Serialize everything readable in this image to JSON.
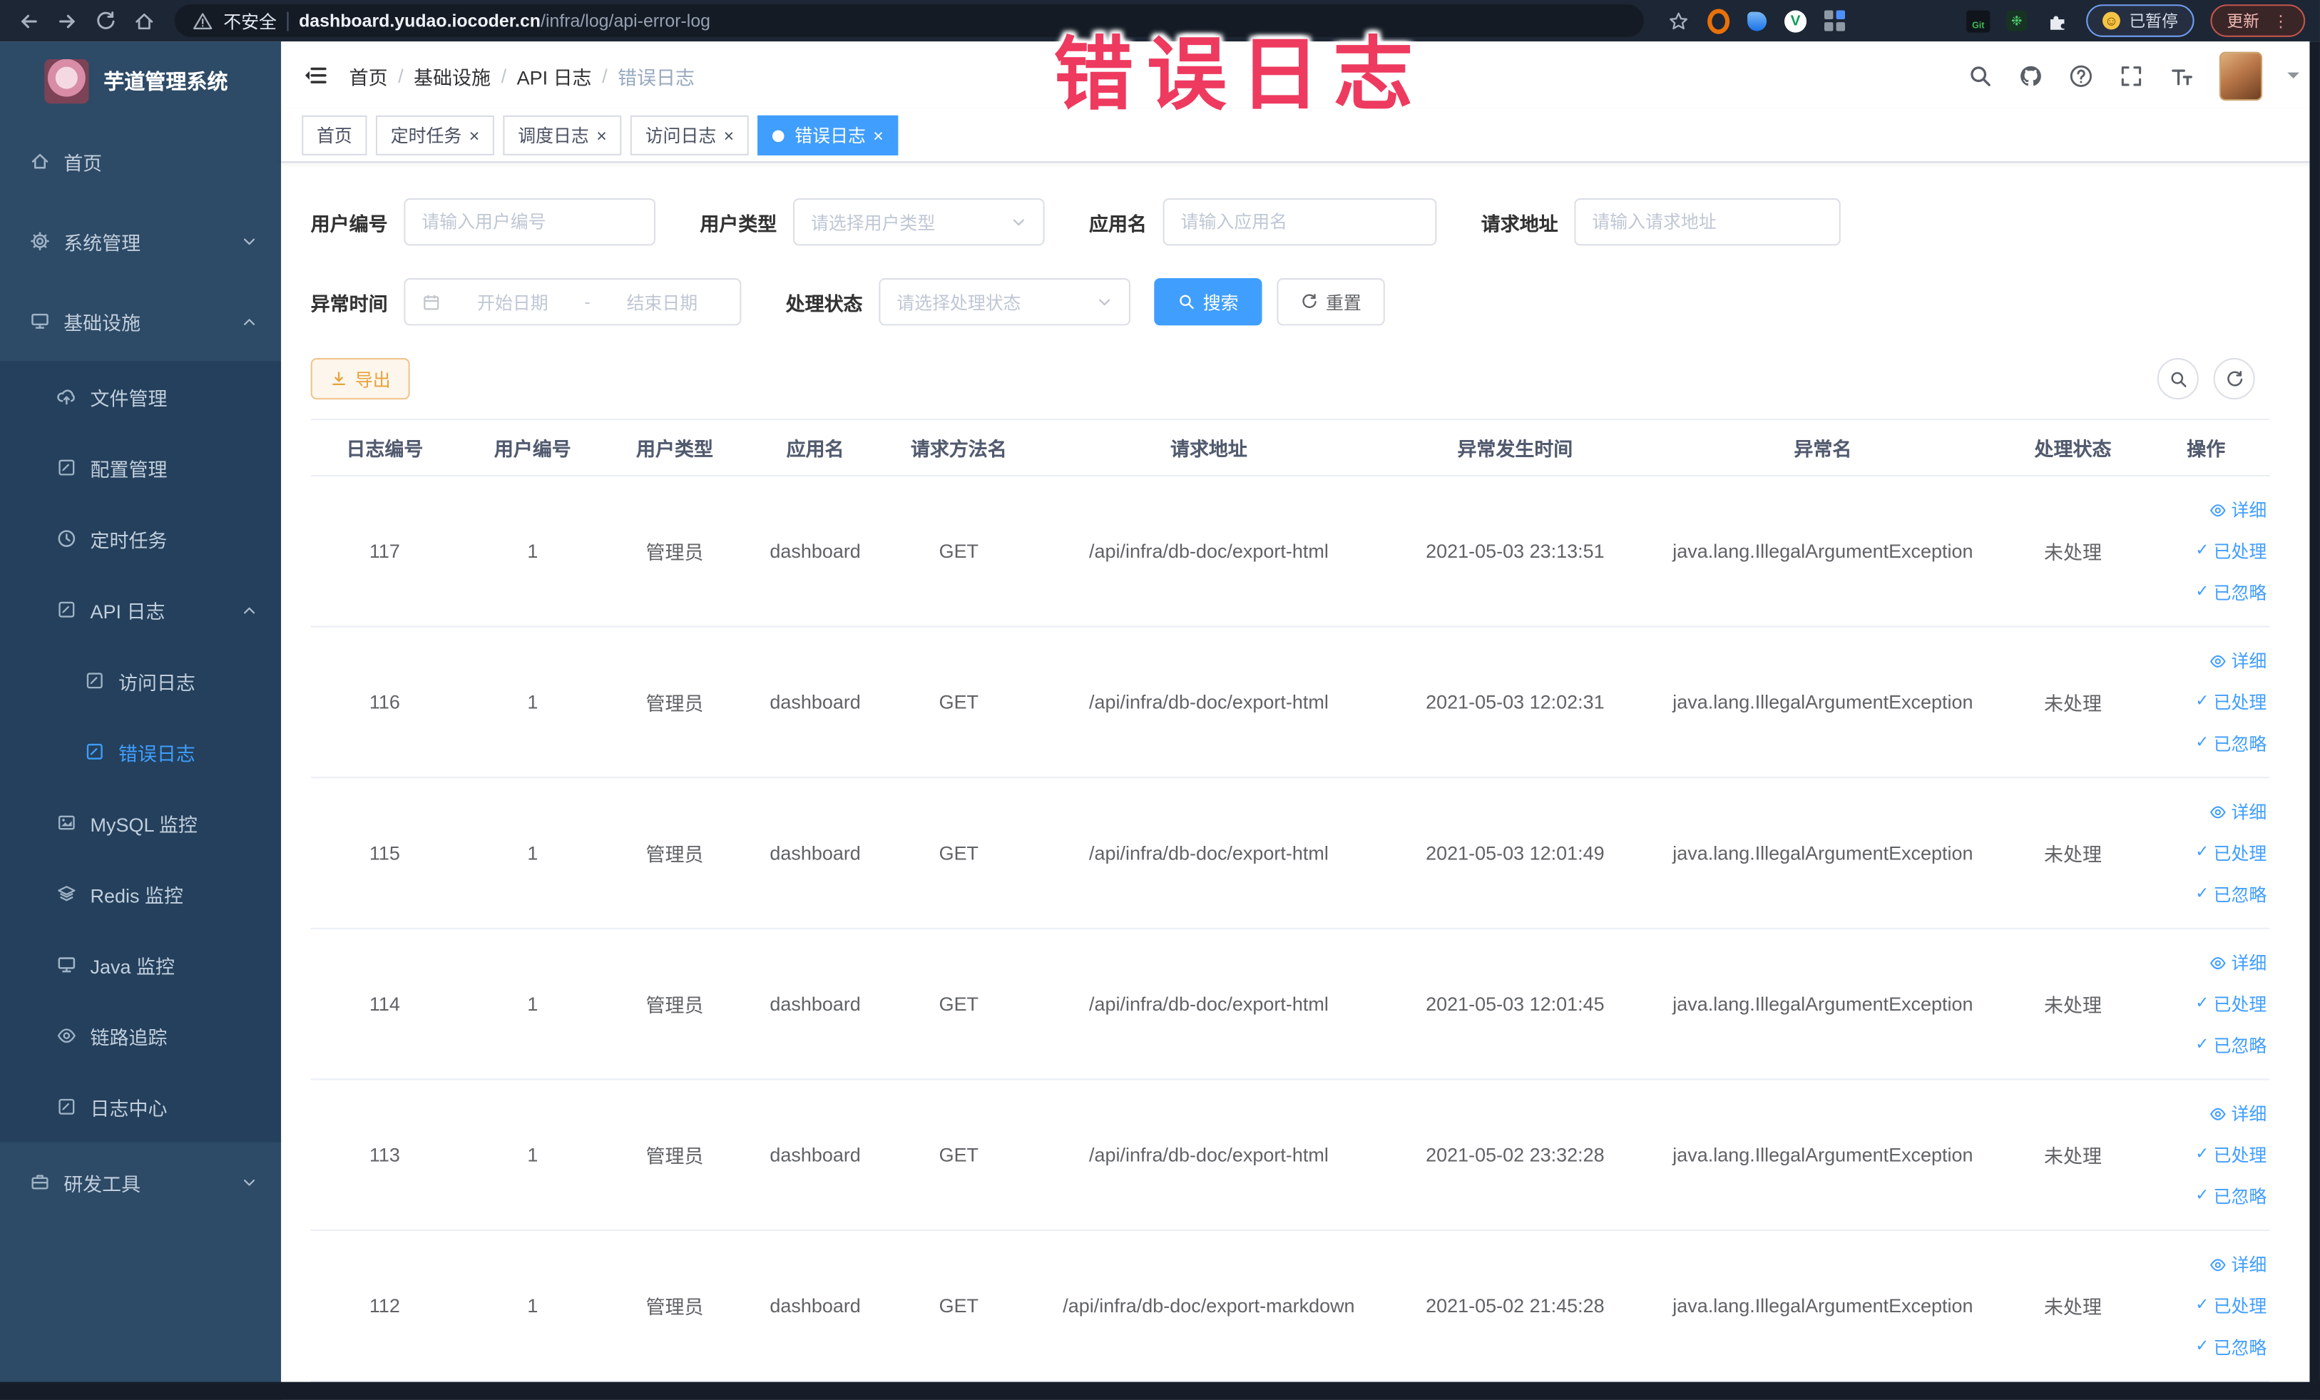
{
  "colors": {
    "accent": "#409eff",
    "warning": "#e6a23c",
    "pink": "#ee3a5f"
  },
  "overlay": {
    "title": "错误日志"
  },
  "browser": {
    "security_label": "不安全",
    "url_domain": "dashboard.yudao.iocoder.cn",
    "url_path": "/infra/log/api-error-log",
    "git_badge": "Git",
    "paused_label": "已暂停",
    "update_label": "更新"
  },
  "sidebar": {
    "app_title": "芋道管理系统",
    "items": [
      {
        "key": "home",
        "label": "首页",
        "icon": "home-icon",
        "depth": 0,
        "section": "light"
      },
      {
        "key": "system-mgmt",
        "label": "系统管理",
        "icon": "gear-icon",
        "depth": 0,
        "section": "light",
        "chevron": "down"
      },
      {
        "key": "infrastructure",
        "label": "基础设施",
        "icon": "monitor-icon",
        "depth": 0,
        "section": "light",
        "chevron": "up"
      },
      {
        "key": "file-mgmt",
        "label": "文件管理",
        "icon": "cloud-upload-icon",
        "depth": 1,
        "section": "dark"
      },
      {
        "key": "config-mgmt",
        "label": "配置管理",
        "icon": "edit-icon",
        "depth": 1,
        "section": "dark"
      },
      {
        "key": "scheduled-jobs",
        "label": "定时任务",
        "icon": "clock-icon",
        "depth": 1,
        "section": "dark"
      },
      {
        "key": "api-log",
        "label": "API 日志",
        "icon": "form-icon",
        "depth": 1,
        "section": "dark",
        "chevron": "up"
      },
      {
        "key": "access-log",
        "label": "访问日志",
        "icon": "form-icon",
        "depth": 2,
        "section": "dark"
      },
      {
        "key": "error-log",
        "label": "错误日志",
        "icon": "form-icon",
        "depth": 2,
        "section": "dark",
        "active": true
      },
      {
        "key": "mysql-monitor",
        "label": "MySQL 监控",
        "icon": "picture-icon",
        "depth": 1,
        "section": "dark"
      },
      {
        "key": "redis-monitor",
        "label": "Redis 监控",
        "icon": "layers-icon",
        "depth": 1,
        "section": "dark"
      },
      {
        "key": "java-monitor",
        "label": "Java 监控",
        "icon": "display-icon",
        "depth": 1,
        "section": "dark"
      },
      {
        "key": "tracing",
        "label": "链路追踪",
        "icon": "eye-icon",
        "depth": 1,
        "section": "dark"
      },
      {
        "key": "log-center",
        "label": "日志中心",
        "icon": "form-icon",
        "depth": 1,
        "section": "dark"
      },
      {
        "key": "dev-tools",
        "label": "研发工具",
        "icon": "toolbox-icon",
        "depth": 0,
        "section": "light",
        "chevron": "down"
      }
    ]
  },
  "header": {
    "breadcrumb": [
      "首页",
      "基础设施",
      "API 日志",
      "错误日志"
    ]
  },
  "tabs": [
    {
      "label": "首页",
      "closable": false,
      "active": false
    },
    {
      "label": "定时任务",
      "closable": true,
      "active": false
    },
    {
      "label": "调度日志",
      "closable": true,
      "active": false
    },
    {
      "label": "访问日志",
      "closable": true,
      "active": false
    },
    {
      "label": "错误日志",
      "closable": true,
      "active": true
    }
  ],
  "filters": {
    "user_id": {
      "label": "用户编号",
      "placeholder": "请输入用户编号"
    },
    "user_type": {
      "label": "用户类型",
      "placeholder": "请选择用户类型"
    },
    "app_name": {
      "label": "应用名",
      "placeholder": "请输入应用名"
    },
    "request_url": {
      "label": "请求地址",
      "placeholder": "请输入请求地址"
    },
    "exception_time": {
      "label": "异常时间",
      "start_placeholder": "开始日期",
      "separator": "-",
      "end_placeholder": "结束日期"
    },
    "process_status": {
      "label": "处理状态",
      "placeholder": "请选择处理状态"
    },
    "search_label": "搜索",
    "reset_label": "重置",
    "export_label": "导出"
  },
  "table": {
    "headers": [
      "日志编号",
      "用户编号",
      "用户类型",
      "应用名",
      "请求方法名",
      "请求地址",
      "异常发生时间",
      "异常名",
      "处理状态",
      "操作"
    ],
    "action_labels": [
      "详细",
      "已处理",
      "已忽略"
    ],
    "rows": [
      {
        "id": "117",
        "user_id": "1",
        "user_type": "管理员",
        "app_name": "dashboard",
        "method": "GET",
        "url": "/api/infra/db-doc/export-html",
        "time": "2021-05-03 23:13:51",
        "exception": "java.lang.IllegalArgumentException",
        "status": "未处理"
      },
      {
        "id": "116",
        "user_id": "1",
        "user_type": "管理员",
        "app_name": "dashboard",
        "method": "GET",
        "url": "/api/infra/db-doc/export-html",
        "time": "2021-05-03 12:02:31",
        "exception": "java.lang.IllegalArgumentException",
        "status": "未处理"
      },
      {
        "id": "115",
        "user_id": "1",
        "user_type": "管理员",
        "app_name": "dashboard",
        "method": "GET",
        "url": "/api/infra/db-doc/export-html",
        "time": "2021-05-03 12:01:49",
        "exception": "java.lang.IllegalArgumentException",
        "status": "未处理"
      },
      {
        "id": "114",
        "user_id": "1",
        "user_type": "管理员",
        "app_name": "dashboard",
        "method": "GET",
        "url": "/api/infra/db-doc/export-html",
        "time": "2021-05-03 12:01:45",
        "exception": "java.lang.IllegalArgumentException",
        "status": "未处理"
      },
      {
        "id": "113",
        "user_id": "1",
        "user_type": "管理员",
        "app_name": "dashboard",
        "method": "GET",
        "url": "/api/infra/db-doc/export-html",
        "time": "2021-05-02 23:32:28",
        "exception": "java.lang.IllegalArgumentException",
        "status": "未处理"
      },
      {
        "id": "112",
        "user_id": "1",
        "user_type": "管理员",
        "app_name": "dashboard",
        "method": "GET",
        "url": "/api/infra/db-doc/export-markdown",
        "time": "2021-05-02 21:45:28",
        "exception": "java.lang.IllegalArgumentException",
        "status": "未处理"
      }
    ]
  }
}
